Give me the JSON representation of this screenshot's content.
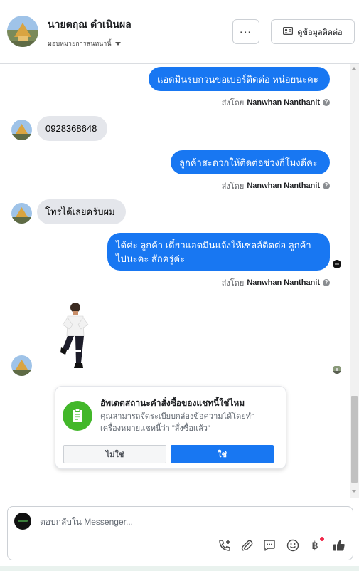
{
  "header": {
    "contact_name": "นายตฤณ ดำเนินผล",
    "assign_label": "มอบหมายการสนทนานี้",
    "more_label": "···",
    "contact_info_label": "ดูข้อมูลติดต่อ"
  },
  "messages": [
    {
      "direction": "out",
      "text": "แอดมินรบกวนขอเบอร์ติดต่อ หน่อยนะคะ",
      "sent_by_prefix": "ส่งโดย",
      "sent_by_name": "Nanwhan Nanthanit"
    },
    {
      "direction": "in",
      "text": "0928368648"
    },
    {
      "direction": "out",
      "text": "ลูกค้าสะดวกให้ติดต่อช่วงกี่โมงดีคะ",
      "sent_by_prefix": "ส่งโดย",
      "sent_by_name": "Nanwhan Nanthanit"
    },
    {
      "direction": "in",
      "text": "โทรได้เลยครับผม"
    },
    {
      "direction": "out",
      "text_line1": "ได้ค่ะ ลูกค้า เดี๋ยวแอดมินแจ้งให้เซลล์ติดต่อ ลูกค้า",
      "text_line2": "ไปนะคะ สักครู่ค่ะ",
      "sent_by_prefix": "ส่งโดย",
      "sent_by_name": "Nanwhan Nanthanit"
    }
  ],
  "order_card": {
    "title": "อัพเดตสถานะคำสั่งซื้อของแชทนี้ใช่ไหม",
    "body_line1": "คุณสามารถจัดระเบียบกล่องข้อความได้โดยทำ",
    "body_line2": "เครื่องหมายแชทนี้ว่า \"สั่งซื้อแล้ว\"",
    "no_label": "ไม่ใช่",
    "yes_label": "ใช่"
  },
  "composer": {
    "placeholder": "ตอบกลับใน Messenger...",
    "currency_symbol": "฿"
  },
  "colors": {
    "primary_blue": "#1877f2",
    "incoming_bubble": "#e4e6eb",
    "order_green": "#42b72a",
    "notification_red": "#f02849"
  },
  "icons": [
    "more-icon",
    "contact-card-icon",
    "help-icon",
    "sticker-person",
    "order-icon",
    "call-add-icon",
    "attach-icon",
    "saved-reply-icon",
    "emoji-icon",
    "baht-icon",
    "thumbs-up-icon"
  ]
}
